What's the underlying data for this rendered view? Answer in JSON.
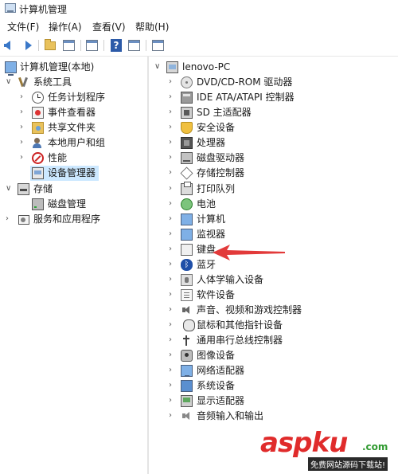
{
  "window": {
    "title": "计算机管理"
  },
  "menu": {
    "items": [
      "文件(F)",
      "操作(A)",
      "查看(V)",
      "帮助(H)"
    ]
  },
  "tree": {
    "root": "计算机管理(本地)",
    "system_tools": "系统工具",
    "task_scheduler": "任务计划程序",
    "event_viewer": "事件查看器",
    "shared_folders": "共享文件夹",
    "local_users": "本地用户和组",
    "performance": "性能",
    "device_manager": "设备管理器",
    "storage": "存储",
    "disk_management": "磁盘管理",
    "services_apps": "服务和应用程序"
  },
  "devices": {
    "computer_name": "lenovo-PC",
    "categories": [
      "DVD/CD-ROM 驱动器",
      "IDE ATA/ATAPI 控制器",
      "SD 主适配器",
      "安全设备",
      "处理器",
      "磁盘驱动器",
      "存储控制器",
      "打印队列",
      "电池",
      "计算机",
      "监视器",
      "键盘",
      "蓝牙",
      "人体学输入设备",
      "软件设备",
      "声音、视频和游戏控制器",
      "鼠标和其他指针设备",
      "通用串行总线控制器",
      "图像设备",
      "网络适配器",
      "系统设备",
      "显示适配器",
      "音频输入和输出"
    ]
  },
  "watermark": {
    "brand": "aspku",
    "domain": ".com",
    "slogan": "免费网站源码下载站!"
  },
  "colors": {
    "selected_bg": "#cce8ff",
    "arrow": "#e23a3a",
    "accent": "#3a78c8"
  }
}
